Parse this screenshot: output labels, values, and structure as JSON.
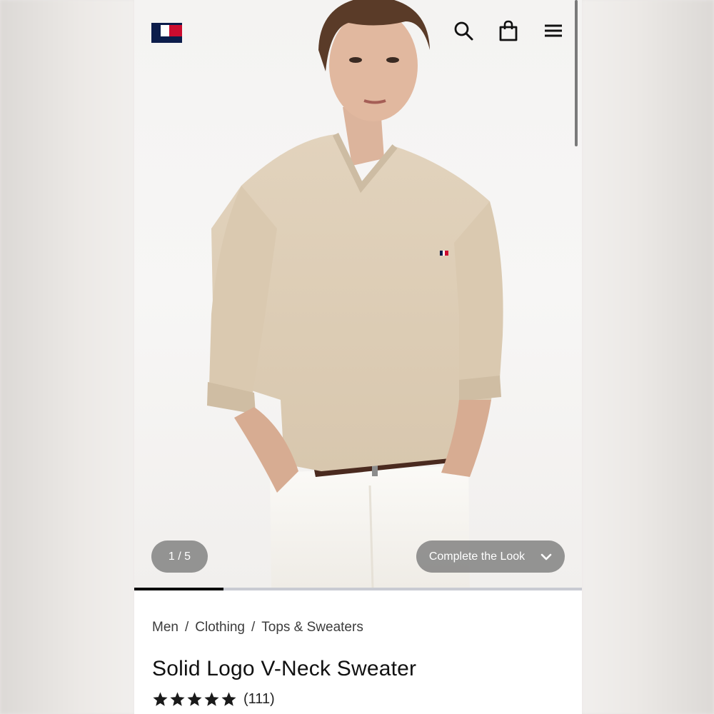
{
  "brand": {
    "logo_name": "tommy-hilfiger-flag",
    "colors": {
      "navy": "#0c1d4b",
      "red": "#cc0c2f"
    }
  },
  "header": {
    "icons": [
      "search-icon",
      "shopping-bag-icon",
      "hamburger-menu-icon"
    ]
  },
  "gallery": {
    "counter": "1 / 5",
    "current_index": 1,
    "total": 5,
    "progress_fraction": 0.2,
    "complete_the_look_label": "Complete the Look"
  },
  "breadcrumb": {
    "items": [
      "Men",
      "Clothing",
      "Tops & Sweaters"
    ],
    "separator": "/"
  },
  "product": {
    "title": "Solid Logo V-Neck Sweater",
    "rating": 5,
    "max_rating": 5,
    "review_count": "(111)"
  }
}
